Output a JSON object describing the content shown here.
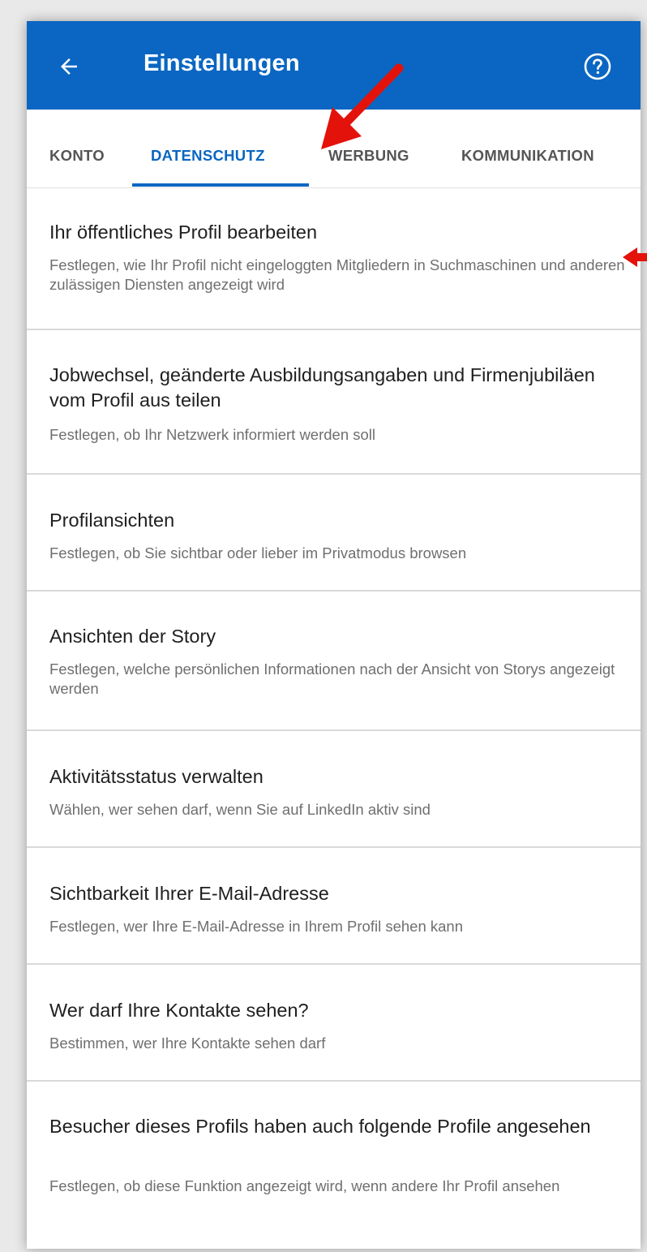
{
  "header": {
    "title": "Einstellungen",
    "back_icon": "arrow-left-icon",
    "help_icon": "help-circle-icon",
    "background_color": "#0a66c2"
  },
  "tabs": [
    {
      "label": "KONTO",
      "active": false
    },
    {
      "label": "DATENSCHUTZ",
      "active": true
    },
    {
      "label": "WERBUNG",
      "active": false
    },
    {
      "label": "KOMMUNIKATION",
      "active": false
    }
  ],
  "settings": [
    {
      "title": "Ihr öffentliches Profil bearbeiten",
      "description": "Festlegen, wie Ihr Profil nicht eingeloggten Mitgliedern in Suchmaschinen und anderen zulässigen Diensten angezeigt wird"
    },
    {
      "title": "Jobwechsel, geänderte Ausbildungsangaben und Firmenjubiläen vom Profil aus teilen",
      "description": "Festlegen, ob Ihr Netzwerk informiert werden soll"
    },
    {
      "title": "Profilansichten",
      "description": "Festlegen, ob Sie sichtbar oder lieber im Privatmodus browsen"
    },
    {
      "title": "Ansichten der Story",
      "description": "Festlegen, welche persönlichen Informationen nach der Ansicht von Storys angezeigt werden"
    },
    {
      "title": "Aktivitätsstatus verwalten",
      "description": "Wählen, wer sehen darf, wenn Sie auf LinkedIn aktiv sind"
    },
    {
      "title": "Sichtbarkeit Ihrer E-Mail-Adresse",
      "description": "Festlegen, wer Ihre E-Mail-Adresse in Ihrem Profil sehen kann"
    },
    {
      "title": "Wer darf Ihre Kontakte sehen?",
      "description": "Bestimmen, wer Ihre Kontakte sehen darf"
    },
    {
      "title": "Besucher dieses Profils haben auch folgende Profile angesehen",
      "description": "Festlegen, ob diese Funktion angezeigt wird, wenn andere Ihr Profil ansehen"
    }
  ],
  "annotation_color": "#e3120b"
}
